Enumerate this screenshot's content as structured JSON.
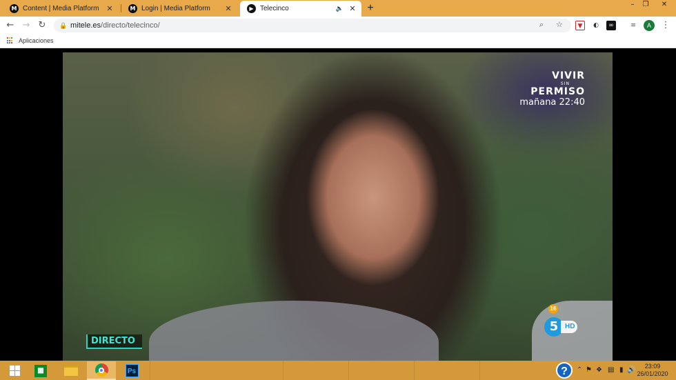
{
  "browser": {
    "tabs": [
      {
        "label": "Content | Media Platform",
        "favicon": "M"
      },
      {
        "label": "Login | Media Platform",
        "favicon": "M"
      },
      {
        "label": "Telecinco",
        "favicon": "play"
      }
    ],
    "active_tab": 2,
    "new_tab_label": "+",
    "window_controls": {
      "minimize": "–",
      "restore": "❐",
      "close": "✕"
    },
    "url_host": "mitele.es",
    "url_path": "/directo/telecinco/",
    "profile_initial": "A",
    "bookmarks": [
      {
        "label": "Aplicaciones"
      }
    ]
  },
  "video": {
    "promo": {
      "line1": "VIVIR",
      "line2": "SIN",
      "line3": "PERMISO",
      "line4": "mañana 22:40"
    },
    "live_badge": "DIRECTO",
    "rating": "16",
    "channel": {
      "number": "5",
      "quality": "HD"
    }
  },
  "taskbar": {
    "clock_time": "23:09",
    "clock_date": "26/01/2020",
    "help_label": "?",
    "ps_label": "Ps"
  }
}
